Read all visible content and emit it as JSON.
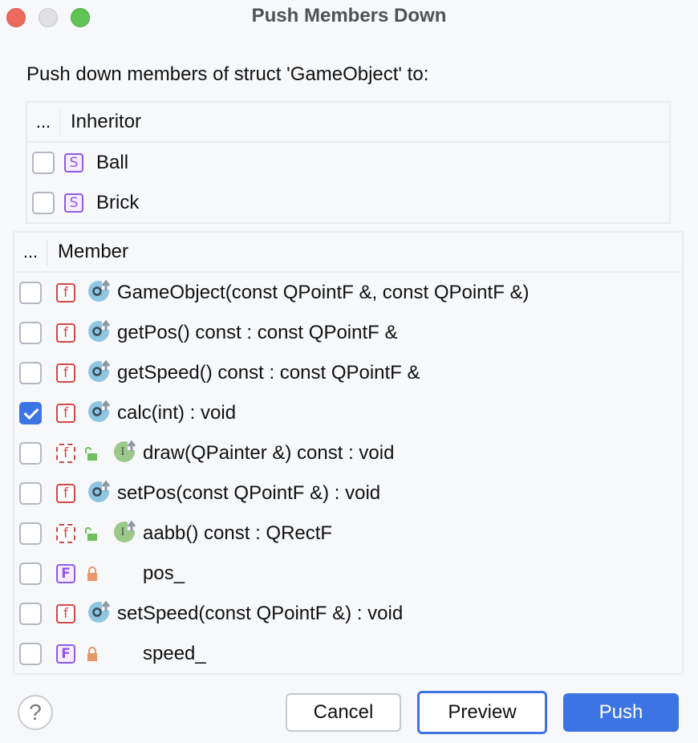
{
  "window": {
    "title": "Push Members Down"
  },
  "prompt": "Push down members of struct 'GameObject' to:",
  "inheritors": {
    "header_dots": "...",
    "header_label": "Inheritor",
    "rows": [
      {
        "checked": false,
        "icon": "struct-icon",
        "badge": "S",
        "name": "Ball"
      },
      {
        "checked": false,
        "icon": "struct-icon",
        "badge": "S",
        "name": "Brick"
      }
    ]
  },
  "members": {
    "header_dots": "...",
    "header_label": "Member",
    "rows": [
      {
        "checked": false,
        "badge": "f",
        "kind": "function",
        "visibility": "none",
        "override": "overrides",
        "label": "GameObject(const QPointF &, const QPointF &)"
      },
      {
        "checked": false,
        "badge": "f",
        "kind": "function",
        "visibility": "none",
        "override": "overrides",
        "label": "getPos() const : const QPointF &"
      },
      {
        "checked": false,
        "badge": "f",
        "kind": "function",
        "visibility": "none",
        "override": "overrides",
        "label": "getSpeed() const : const QPointF &"
      },
      {
        "checked": true,
        "badge": "f",
        "kind": "function",
        "visibility": "none",
        "override": "overrides",
        "label": "calc(int) : void"
      },
      {
        "checked": false,
        "badge": "f",
        "kind": "abstract-function",
        "visibility": "public",
        "override": "implements",
        "label": "draw(QPainter &) const : void"
      },
      {
        "checked": false,
        "badge": "f",
        "kind": "function",
        "visibility": "none",
        "override": "overrides",
        "label": "setPos(const QPointF &) : void"
      },
      {
        "checked": false,
        "badge": "f",
        "kind": "abstract-function",
        "visibility": "public",
        "override": "implements",
        "label": "aabb() const : QRectF"
      },
      {
        "checked": false,
        "badge": "F",
        "kind": "field",
        "visibility": "private",
        "override": "none",
        "label": "pos_"
      },
      {
        "checked": false,
        "badge": "f",
        "kind": "function",
        "visibility": "none",
        "override": "overrides",
        "label": "setSpeed(const QPointF &) : void"
      },
      {
        "checked": false,
        "badge": "F",
        "kind": "field",
        "visibility": "private",
        "override": "none",
        "label": "speed_"
      }
    ]
  },
  "buttons": {
    "help": "?",
    "cancel": "Cancel",
    "preview": "Preview",
    "push": "Push"
  },
  "colors": {
    "accent": "#3d74e4",
    "function_badge": "#d24848",
    "struct_badge": "#8d5be6",
    "override_icon": "#8ec6e2",
    "implements_icon": "#9bc98a",
    "public_lock": "#6fbf5e",
    "private_lock": "#e8966a"
  }
}
